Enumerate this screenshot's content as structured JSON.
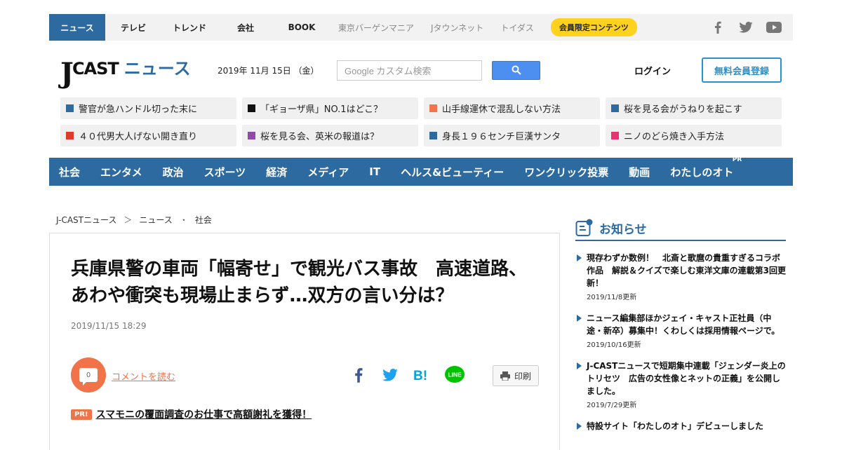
{
  "topbar": {
    "tabs": [
      "ニュース",
      "テレビ",
      "トレンド",
      "会社",
      "BOOK"
    ],
    "sub_tabs": [
      "東京バーゲンマニア",
      "Jタウンネット",
      "トイダス"
    ],
    "member_pill": "会員限定コンテンツ",
    "social": [
      "facebook-icon",
      "twitter-icon",
      "youtube-icon"
    ]
  },
  "header": {
    "logo_j": "J",
    "logo_cast": "CAST",
    "logo_news": "ニュース",
    "date": "2019年 11月 15日 （金）",
    "search_placeholder": "Google カスタム検索",
    "login": "ログイン",
    "signup": "無料会員登録"
  },
  "headlines": [
    {
      "text": "警官が急ハンドル切った末に",
      "color": "#2c6aa0"
    },
    {
      "text": "「ギョーザ県」NO.1はどこ？",
      "color": "#111111"
    },
    {
      "text": "山手線運休で混乱しない方法",
      "color": "#f0734a"
    },
    {
      "text": "桜を見る会がうねりを起こす",
      "color": "#2c6aa0"
    },
    {
      "text": "４０代男大人げない開き直り",
      "color": "#e03a2a"
    },
    {
      "text": "桜を見る会、英米の報道は？",
      "color": "#8e4ca8"
    },
    {
      "text": "身長１９６センチ巨漢サンタ",
      "color": "#2c6aa0"
    },
    {
      "text": "ニノのどら焼き入手方法",
      "color": "#e8336f"
    }
  ],
  "categories": [
    "社会",
    "エンタメ",
    "政治",
    "スポーツ",
    "経済",
    "メディア",
    "IT",
    "ヘルス&ビューティー",
    "ワンクリック投票",
    "動画",
    "わたしのオト"
  ],
  "category_pr": "PR",
  "breadcrumb": [
    "J-CASTニュース",
    "＞",
    "ニュース",
    "・",
    "社会"
  ],
  "article": {
    "title": "兵庫県警の車両「幅寄せ」で観光バス事故　高速道路、あわや衝突も現場止まらず…双方の言い分は？",
    "date": "2019/11/15 18:29",
    "comment_count": "0",
    "comment_link": "コメントを読む",
    "print": "印刷",
    "pr_badge": "PR!",
    "pr_text": "スマモニの覆面調査のお仕事で高額謝礼を獲得！"
  },
  "sidebar": {
    "title": "お知らせ",
    "notices": [
      {
        "text": "現存わずか数例！　北斎と歌麿の貴重すぎるコラボ作品　解説＆クイズで楽しむ東洋文庫の連載第3回更新！",
        "date": "2019/11/8更新"
      },
      {
        "text": "ニュース編集部ほかジェイ・キャスト正社員（中途・新卒）募集中！くわしくは採用情報ページで。",
        "date": "2019/10/16更新"
      },
      {
        "text": "J-CASTニュースで短期集中連載「ジェンダー炎上のトリセツ　広告の女性像とネットの正義」を公開しました。",
        "date": "2019/7/29更新"
      },
      {
        "text": "特設サイト「わたしのオト」デビューしました",
        "date": ""
      }
    ]
  }
}
